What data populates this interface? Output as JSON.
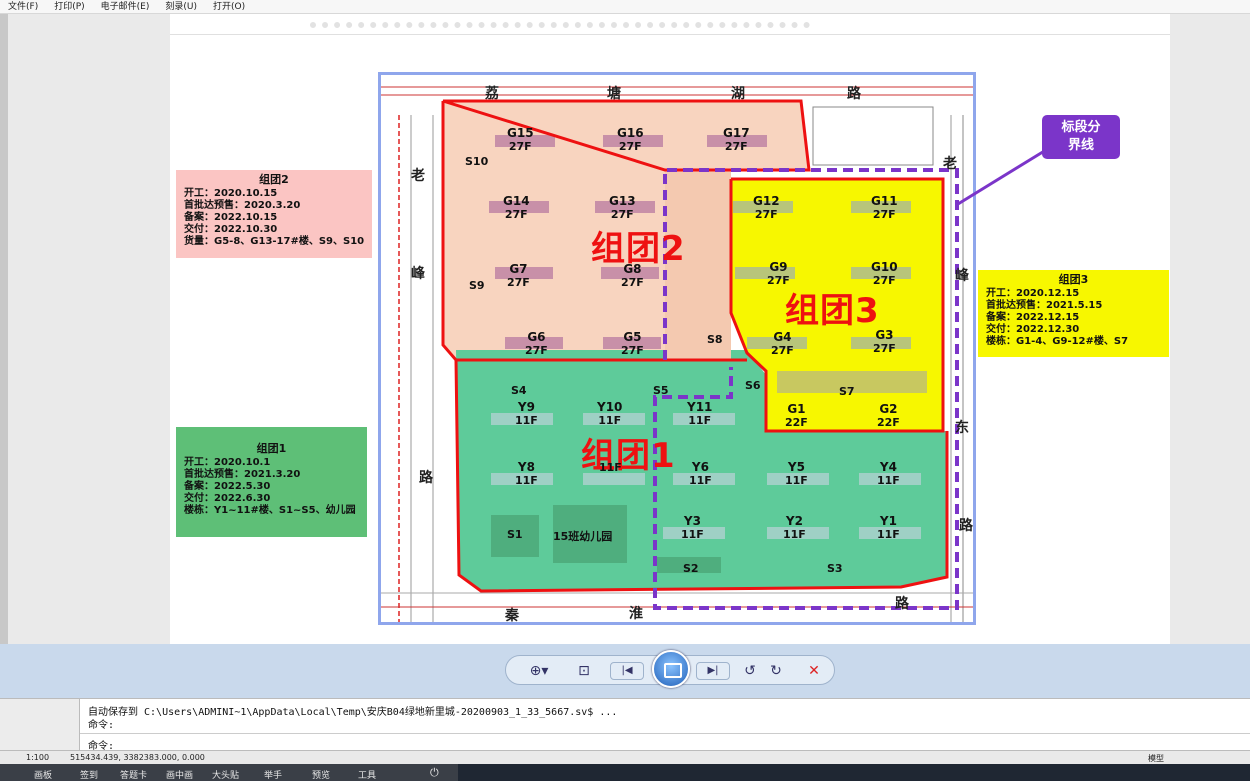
{
  "menu": [
    "文件(F)",
    "打印(P)",
    "电子邮件(E)",
    "刻录(U)",
    "打开(O)"
  ],
  "roads": {
    "top": [
      "荔",
      "塘",
      "湖",
      "路"
    ],
    "left": [
      "老",
      "峰",
      "路"
    ],
    "bottom": [
      "秦",
      "淮",
      "路"
    ],
    "right": [
      "老",
      "峰",
      "东",
      "路"
    ]
  },
  "clusters": {
    "c1": "组团1",
    "c2": "组团2",
    "c3": "组团3"
  },
  "buildings": {
    "g15": {
      "n": "G15",
      "f": "27F"
    },
    "g16": {
      "n": "G16",
      "f": "27F"
    },
    "g17": {
      "n": "G17",
      "f": "27F"
    },
    "g14": {
      "n": "G14",
      "f": "27F"
    },
    "g13": {
      "n": "G13",
      "f": "27F"
    },
    "g12": {
      "n": "G12",
      "f": "27F"
    },
    "g11": {
      "n": "G11",
      "f": "27F"
    },
    "g7": {
      "n": "G7",
      "f": "27F"
    },
    "g8": {
      "n": "G8",
      "f": "27F"
    },
    "g9": {
      "n": "G9",
      "f": "27F"
    },
    "g10": {
      "n": "G10",
      "f": "27F"
    },
    "g6": {
      "n": "G6",
      "f": "27F"
    },
    "g5": {
      "n": "G5",
      "f": "27F"
    },
    "g4": {
      "n": "G4",
      "f": "27F"
    },
    "g3": {
      "n": "G3",
      "f": "27F"
    },
    "g1": {
      "n": "G1",
      "f": "22F"
    },
    "g2": {
      "n": "G2",
      "f": "22F"
    },
    "y9": {
      "n": "Y9",
      "f": "11F"
    },
    "y10": {
      "n": "Y10",
      "f": "11F"
    },
    "y11": {
      "n": "Y11",
      "f": "11F"
    },
    "y8": {
      "n": "Y8",
      "f": "11F"
    },
    "y7": {
      "n": "",
      "f": "11F"
    },
    "y6": {
      "n": "Y6",
      "f": "11F"
    },
    "y5": {
      "n": "Y5",
      "f": "11F"
    },
    "y4": {
      "n": "Y4",
      "f": "11F"
    },
    "y3": {
      "n": "Y3",
      "f": "11F"
    },
    "y2": {
      "n": "Y2",
      "f": "11F"
    },
    "y1": {
      "n": "Y1",
      "f": "11F"
    }
  },
  "service": {
    "s10": "S10",
    "s9": "S9",
    "s8": "S8",
    "s4": "S4",
    "s5": "S5",
    "s6": "S6",
    "s7": "S7",
    "s1": "S1",
    "s2": "S2",
    "s3": "S3",
    "kindergarten": "15班幼儿园"
  },
  "callout": {
    "line1": "标段分",
    "line2": "界线"
  },
  "info2": {
    "title": "组团2",
    "lines": [
      "开工：2020.10.15",
      "首批达预售：2020.3.20",
      "备案：2022.10.15",
      "交付：2022.10.30",
      "货量：G5-8、G13-17#楼、S9、S10"
    ]
  },
  "info3": {
    "title": "组团3",
    "lines": [
      "开工：2020.12.15",
      "首批达预售：2021.5.15",
      "备案：2022.12.15",
      "交付：2022.12.30",
      "楼栋：G1-4、G9-12#楼、S7"
    ]
  },
  "info1": {
    "title": "组团1",
    "lines": [
      "开工：2020.10.1",
      "首批达预售：2021.3.20",
      "备案：2022.5.30",
      "交付：2022.6.30",
      "楼栋：Y1~11#楼、S1~S5、幼儿园"
    ]
  },
  "command": {
    "line1": "自动保存到 C:\\Users\\ADMINI~1\\AppData\\Local\\Temp\\安庆B04绿地新里城-20200903_1_33_5667.sv$ ...",
    "line2": "命令:",
    "line3": "命令:"
  },
  "status": {
    "scale": "1:100",
    "coords": "515434.439, 3382383.000, 0.000",
    "model": "模型"
  },
  "taskbar": [
    "画板",
    "签到",
    "答题卡",
    "画中画",
    "大头贴",
    "举手",
    "预览",
    "工具"
  ],
  "colors": {
    "cluster_red": "#ee1111",
    "boundary_purple": "#7b35c9",
    "cluster2_fill": "#f8d4bf",
    "cluster3_fill": "#f7f700",
    "cluster1_fill": "#5ecb9a"
  }
}
